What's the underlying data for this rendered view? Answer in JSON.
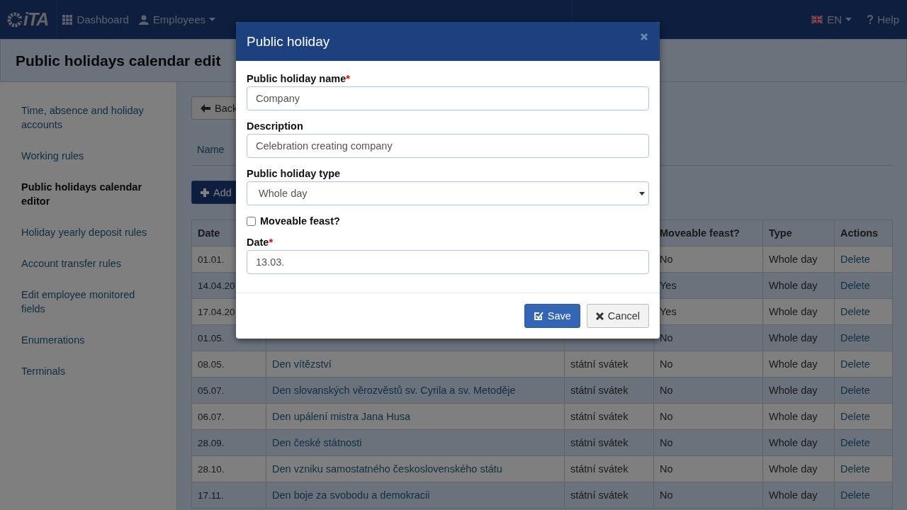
{
  "navbar": {
    "logo": "iTA",
    "items": [
      {
        "label": "Dashboard",
        "dropdown": false
      },
      {
        "label": "Employees",
        "dropdown": true
      }
    ],
    "language": "EN",
    "help": "Help"
  },
  "page_title": "Public holidays calendar edit",
  "sidebar": {
    "items": [
      {
        "label": "Time, absence and holiday accounts",
        "selected": false
      },
      {
        "label": "Working rules",
        "selected": false
      },
      {
        "label": "Public holidays calendar editor",
        "selected": true
      },
      {
        "label": "Holiday yearly deposit rules",
        "selected": false
      },
      {
        "label": "Account transfer rules",
        "selected": false
      },
      {
        "label": "Edit employee monitored fields",
        "selected": false
      },
      {
        "label": "Enumerations",
        "selected": false
      },
      {
        "label": "Terminals",
        "selected": false
      }
    ]
  },
  "back_button": "Back",
  "tabs": [
    {
      "label": "Name",
      "selected": false
    }
  ],
  "add_button": "Add",
  "table": {
    "columns": [
      "Date",
      null,
      null,
      "Moveable feast?",
      "Type",
      "Actions"
    ],
    "rows": [
      {
        "date": "01.01.",
        "moveable": "No",
        "type": "Whole day",
        "action": "Delete"
      },
      {
        "date": "14.04.20",
        "moveable": "Yes",
        "type": "Whole day",
        "action": "Delete"
      },
      {
        "date": "17.04.20",
        "moveable": "Yes",
        "type": "Whole day",
        "action": "Delete"
      },
      {
        "date": "01.05.",
        "moveable": "No",
        "type": "Whole day",
        "action": "Delete"
      },
      {
        "date": "08.05.",
        "name": "Den vítězství",
        "holiday_type": "státní svátek",
        "moveable": "No",
        "type": "Whole day",
        "action": "Delete"
      },
      {
        "date": "05.07.",
        "name": "Den slovanských věrozvěstů sv. Cyrila a sv. Metoděje",
        "holiday_type": "státní svátek",
        "moveable": "No",
        "type": "Whole day",
        "action": "Delete"
      },
      {
        "date": "06.07.",
        "name": "Den upálení mistra Jana Husa",
        "holiday_type": "státní svátek",
        "moveable": "No",
        "type": "Whole day",
        "action": "Delete"
      },
      {
        "date": "28.09.",
        "name": "Den české státnosti",
        "holiday_type": "státní svátek",
        "moveable": "No",
        "type": "Whole day",
        "action": "Delete"
      },
      {
        "date": "28.10.",
        "name": "Den vzniku samostatného československého státu",
        "holiday_type": "státní svátek",
        "moveable": "No",
        "type": "Whole day",
        "action": "Delete"
      },
      {
        "date": "17.11.",
        "name": "Den boje za svobodu a demokracii",
        "holiday_type": "státní svátek",
        "moveable": "No",
        "type": "Whole day",
        "action": "Delete"
      }
    ]
  },
  "modal": {
    "title": "Public holiday",
    "fields": [
      {
        "kind": "text",
        "label": "Public holiday name",
        "required_mark": "*",
        "value": "Company"
      },
      {
        "kind": "text",
        "label": "Description",
        "value": "Celebration creating company"
      },
      {
        "kind": "select",
        "label": "Public holiday type",
        "value": "Whole day"
      },
      {
        "kind": "checkbox",
        "label": "Moveable feast?",
        "checked": false
      },
      {
        "kind": "text",
        "label": "Date",
        "required_mark": "*",
        "value": "13.03."
      }
    ],
    "buttons": [
      {
        "kind": "primary",
        "label": "Save"
      },
      {
        "kind": "cancel",
        "label": "Cancel"
      }
    ]
  }
}
